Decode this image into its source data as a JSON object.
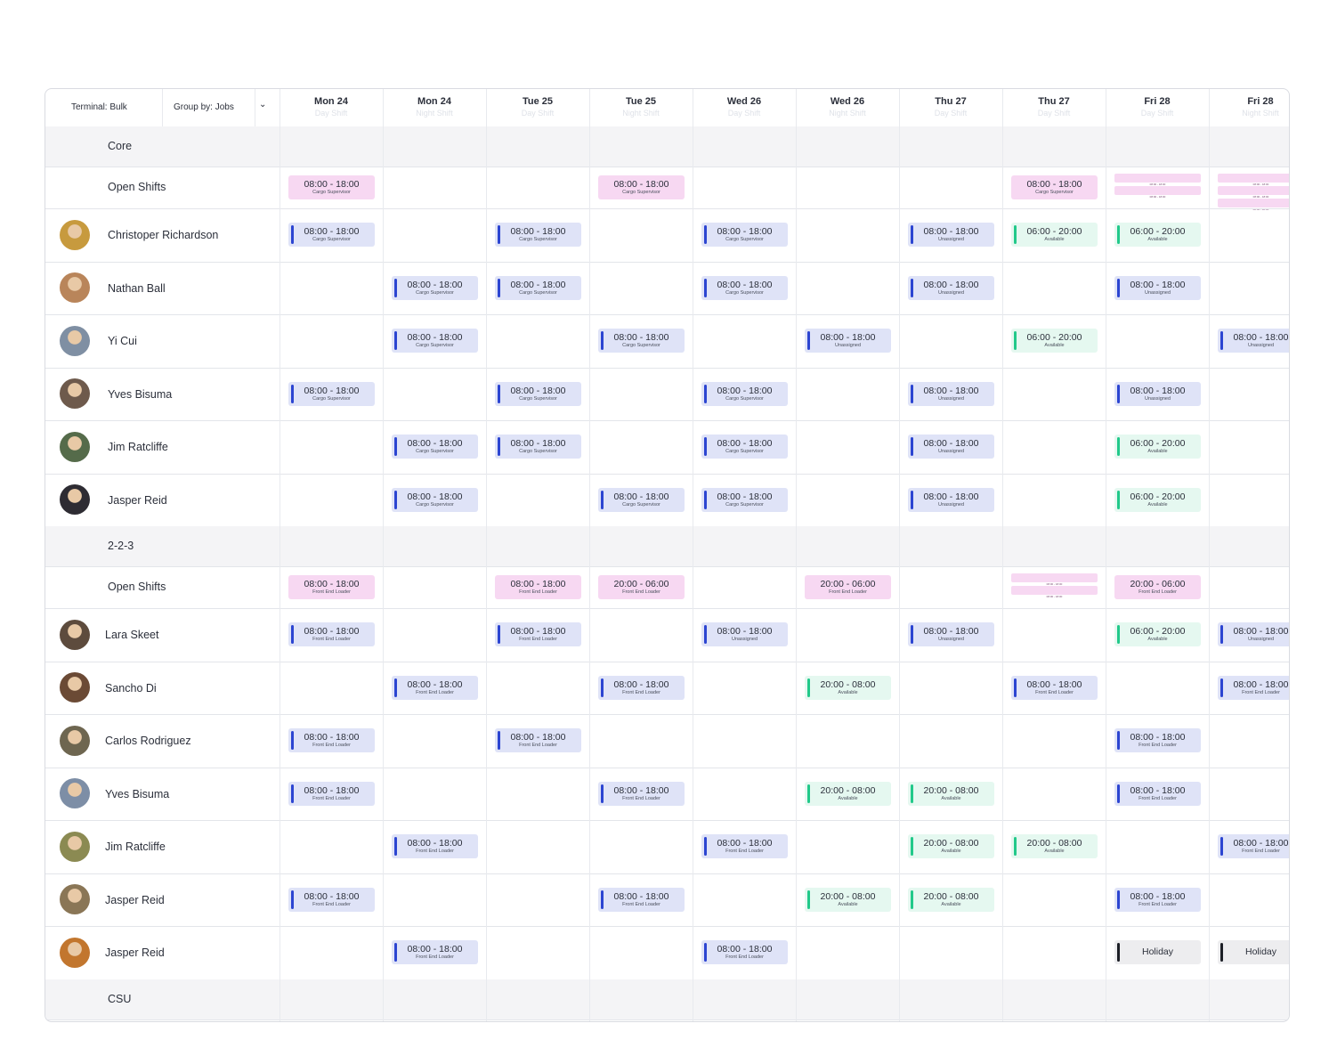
{
  "toolbar": {
    "terminal_label": "Terminal: Bulk",
    "group_label": "Group by: Jobs"
  },
  "days": [
    {
      "day": "Mon 24",
      "shift": "Day Shift"
    },
    {
      "day": "Mon 24",
      "shift": "Night Shift"
    },
    {
      "day": "Tue 25",
      "shift": "Day Shift"
    },
    {
      "day": "Tue 25",
      "shift": "Night Shift"
    },
    {
      "day": "Wed 26",
      "shift": "Day Shift"
    },
    {
      "day": "Wed 26",
      "shift": "Night Shift"
    },
    {
      "day": "Thu 27",
      "shift": "Day Shift"
    },
    {
      "day": "Thu 27",
      "shift": "Day Shift"
    },
    {
      "day": "Fri 28",
      "shift": "Day Shift"
    },
    {
      "day": "Fri 28",
      "shift": "Night Shift"
    }
  ],
  "groups": [
    {
      "name": "Core",
      "open_shifts": {
        "label": "Open Shifts",
        "cells": [
          {
            "type": "open",
            "time": "08:00 - 18:00",
            "role": "Cargo Supervisor"
          },
          null,
          null,
          {
            "type": "open",
            "time": "08:00 - 18:00",
            "role": "Cargo Supervisor"
          },
          null,
          null,
          null,
          {
            "type": "open",
            "time": "08:00 - 18:00",
            "role": "Cargo Supervisor"
          },
          {
            "type": "multi",
            "count": 2,
            "text": "08:00 - 18:00"
          },
          {
            "type": "multi",
            "count": 3,
            "text": "08:00 - 18:00"
          }
        ]
      },
      "people": [
        {
          "name": "Christoper Richardson",
          "avatar_color": "#c79a3e",
          "cells": [
            {
              "type": "assigned",
              "time": "08:00 - 18:00",
              "role": "Cargo Supervisor"
            },
            null,
            {
              "type": "assigned",
              "time": "08:00 - 18:00",
              "role": "Cargo Supervisor"
            },
            null,
            {
              "type": "assigned",
              "time": "08:00 - 18:00",
              "role": "Cargo Supervisor"
            },
            null,
            {
              "type": "assigned",
              "time": "08:00 - 18:00",
              "role": "Unassigned"
            },
            {
              "type": "available",
              "time": "06:00 - 20:00",
              "role": "Available"
            },
            {
              "type": "available",
              "time": "06:00 - 20:00",
              "role": "Available"
            },
            null
          ]
        },
        {
          "name": "Nathan Ball",
          "avatar_color": "#b9855a",
          "cells": [
            null,
            {
              "type": "assigned",
              "time": "08:00 - 18:00",
              "role": "Cargo Supervisor"
            },
            {
              "type": "assigned",
              "time": "08:00 - 18:00",
              "role": "Cargo Supervisor"
            },
            null,
            {
              "type": "assigned",
              "time": "08:00 - 18:00",
              "role": "Cargo Supervisor"
            },
            null,
            {
              "type": "assigned",
              "time": "08:00 - 18:00",
              "role": "Unassigned"
            },
            null,
            {
              "type": "assigned",
              "time": "08:00 - 18:00",
              "role": "Unassigned"
            },
            null
          ]
        },
        {
          "name": "Yi Cui",
          "avatar_color": "#7f8fa3",
          "cells": [
            null,
            {
              "type": "assigned",
              "time": "08:00 - 18:00",
              "role": "Cargo Supervisor"
            },
            null,
            {
              "type": "assigned",
              "time": "08:00 - 18:00",
              "role": "Cargo Supervisor"
            },
            null,
            {
              "type": "assigned",
              "time": "08:00 - 18:00",
              "role": "Unassigned"
            },
            null,
            {
              "type": "available",
              "time": "06:00 - 20:00",
              "role": "Available"
            },
            null,
            {
              "type": "assigned",
              "time": "08:00 - 18:00",
              "role": "Unassigned"
            }
          ]
        },
        {
          "name": "Yves Bisuma",
          "avatar_color": "#6e5a4c",
          "cells": [
            {
              "type": "assigned",
              "time": "08:00 - 18:00",
              "role": "Cargo Supervisor"
            },
            null,
            {
              "type": "assigned",
              "time": "08:00 - 18:00",
              "role": "Cargo Supervisor"
            },
            null,
            {
              "type": "assigned",
              "time": "08:00 - 18:00",
              "role": "Cargo Supervisor"
            },
            null,
            {
              "type": "assigned",
              "time": "08:00 - 18:00",
              "role": "Unassigned"
            },
            null,
            {
              "type": "assigned",
              "time": "08:00 - 18:00",
              "role": "Unassigned"
            },
            null
          ]
        },
        {
          "name": "Jim Ratcliffe",
          "avatar_color": "#556b4a",
          "cells": [
            null,
            {
              "type": "assigned",
              "time": "08:00 - 18:00",
              "role": "Cargo Supervisor"
            },
            {
              "type": "assigned",
              "time": "08:00 - 18:00",
              "role": "Cargo Supervisor"
            },
            null,
            {
              "type": "assigned",
              "time": "08:00 - 18:00",
              "role": "Cargo Supervisor"
            },
            null,
            {
              "type": "assigned",
              "time": "08:00 - 18:00",
              "role": "Unassigned"
            },
            null,
            {
              "type": "available",
              "time": "06:00 - 20:00",
              "role": "Available"
            },
            null
          ]
        },
        {
          "name": "Jasper Reid",
          "avatar_color": "#2e2c33",
          "cells": [
            null,
            {
              "type": "assigned",
              "time": "08:00 - 18:00",
              "role": "Cargo Supervisor"
            },
            null,
            {
              "type": "assigned",
              "time": "08:00 - 18:00",
              "role": "Cargo Supervisor"
            },
            {
              "type": "assigned",
              "time": "08:00 - 18:00",
              "role": "Cargo Supervisor"
            },
            null,
            {
              "type": "assigned",
              "time": "08:00 - 18:00",
              "role": "Unassigned"
            },
            null,
            {
              "type": "available",
              "time": "06:00 - 20:00",
              "role": "Available"
            },
            null
          ]
        }
      ]
    },
    {
      "name": "2-2-3",
      "open_shifts": {
        "label": "Open Shifts",
        "cells": [
          {
            "type": "open",
            "time": "08:00 - 18:00",
            "role": "Front End Loader"
          },
          null,
          {
            "type": "open",
            "time": "08:00 - 18:00",
            "role": "Front End Loader"
          },
          {
            "type": "open",
            "time": "20:00 - 06:00",
            "role": "Front End Loader"
          },
          null,
          {
            "type": "open",
            "time": "20:00 - 06:00",
            "role": "Front End Loader"
          },
          null,
          {
            "type": "multi",
            "count": 2,
            "text": "08:00 - 18:00"
          },
          {
            "type": "open",
            "time": "20:00 - 06:00",
            "role": "Front End Loader"
          },
          null
        ]
      },
      "people": [
        {
          "name": "Lara Skeet",
          "avatar_color": "#5d4b3d",
          "cells": [
            {
              "type": "assigned",
              "time": "08:00 - 18:00",
              "role": "Front End Loader"
            },
            null,
            {
              "type": "assigned",
              "time": "08:00 - 18:00",
              "role": "Front End Loader"
            },
            null,
            {
              "type": "assigned",
              "time": "08:00 - 18:00",
              "role": "Unassigned"
            },
            null,
            {
              "type": "assigned",
              "time": "08:00 - 18:00",
              "role": "Unassigned"
            },
            null,
            {
              "type": "available",
              "time": "06:00 - 20:00",
              "role": "Available"
            },
            {
              "type": "assigned",
              "time": "08:00 - 18:00",
              "role": "Unassigned"
            }
          ]
        },
        {
          "name": "Sancho Di",
          "avatar_color": "#6b4a35",
          "cells": [
            null,
            {
              "type": "assigned",
              "time": "08:00 - 18:00",
              "role": "Front End Loader"
            },
            null,
            {
              "type": "assigned",
              "time": "08:00 - 18:00",
              "role": "Front End Loader"
            },
            null,
            {
              "type": "available",
              "time": "20:00 - 08:00",
              "role": "Available"
            },
            null,
            {
              "type": "assigned",
              "time": "08:00 - 18:00",
              "role": "Front End Loader"
            },
            null,
            {
              "type": "assigned",
              "time": "08:00 - 18:00",
              "role": "Front End Loader"
            }
          ]
        },
        {
          "name": "Carlos Rodriguez",
          "avatar_color": "#6e6650",
          "cells": [
            {
              "type": "assigned",
              "time": "08:00 - 18:00",
              "role": "Front End Loader"
            },
            null,
            {
              "type": "assigned",
              "time": "08:00 - 18:00",
              "role": "Front End Loader"
            },
            null,
            null,
            null,
            null,
            null,
            {
              "type": "assigned",
              "time": "08:00 - 18:00",
              "role": "Front End Loader"
            },
            null
          ]
        },
        {
          "name": "Yves Bisuma",
          "avatar_color": "#7d8ea6",
          "cells": [
            {
              "type": "assigned",
              "time": "08:00 - 18:00",
              "role": "Front End Loader"
            },
            null,
            null,
            {
              "type": "assigned",
              "time": "08:00 - 18:00",
              "role": "Front End Loader"
            },
            null,
            {
              "type": "available",
              "time": "20:00 - 08:00",
              "role": "Available"
            },
            {
              "type": "available",
              "time": "20:00 - 08:00",
              "role": "Available"
            },
            null,
            {
              "type": "assigned",
              "time": "08:00 - 18:00",
              "role": "Front End Loader"
            },
            null
          ]
        },
        {
          "name": "Jim Ratcliffe",
          "avatar_color": "#8b8a52",
          "cells": [
            null,
            {
              "type": "assigned",
              "time": "08:00 - 18:00",
              "role": "Front End Loader"
            },
            null,
            null,
            {
              "type": "assigned",
              "time": "08:00 - 18:00",
              "role": "Front End Loader"
            },
            null,
            {
              "type": "available",
              "time": "20:00 - 08:00",
              "role": "Available"
            },
            {
              "type": "available",
              "time": "20:00 - 08:00",
              "role": "Available"
            },
            null,
            {
              "type": "assigned",
              "time": "08:00 - 18:00",
              "role": "Front End Loader"
            }
          ]
        },
        {
          "name": "Jasper Reid",
          "avatar_color": "#8a7656",
          "cells": [
            {
              "type": "assigned",
              "time": "08:00 - 18:00",
              "role": "Front End Loader"
            },
            null,
            null,
            {
              "type": "assigned",
              "time": "08:00 - 18:00",
              "role": "Front End Loader"
            },
            null,
            {
              "type": "available",
              "time": "20:00 - 08:00",
              "role": "Available"
            },
            {
              "type": "available",
              "time": "20:00 - 08:00",
              "role": "Available"
            },
            null,
            {
              "type": "assigned",
              "time": "08:00 - 18:00",
              "role": "Front End Loader"
            },
            null
          ]
        },
        {
          "name": "Jasper Reid",
          "avatar_color": "#c2762e",
          "cells": [
            null,
            {
              "type": "assigned",
              "time": "08:00 - 18:00",
              "role": "Front End Loader"
            },
            null,
            null,
            {
              "type": "assigned",
              "time": "08:00 - 18:00",
              "role": "Front End Loader"
            },
            null,
            null,
            null,
            {
              "type": "holiday",
              "time": "Holiday"
            },
            {
              "type": "holiday",
              "time": "Holiday"
            }
          ]
        }
      ]
    },
    {
      "name": "CSU",
      "people": []
    }
  ]
}
